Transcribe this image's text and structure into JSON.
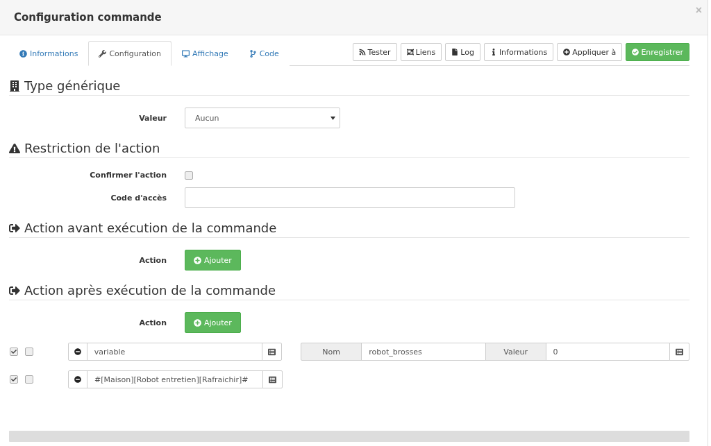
{
  "window": {
    "title": "Configuration commande",
    "close": "×"
  },
  "tabs": [
    {
      "label": "Informations",
      "selected": false
    },
    {
      "label": "Configuration",
      "selected": true
    },
    {
      "label": "Affichage",
      "selected": false
    },
    {
      "label": "Code",
      "selected": false
    }
  ],
  "toolbar": [
    {
      "label": "Tester",
      "kind": "default"
    },
    {
      "label": "Liens",
      "kind": "default"
    },
    {
      "label": "Log",
      "kind": "default"
    },
    {
      "label": "Informations",
      "kind": "default"
    },
    {
      "label": "Appliquer à",
      "kind": "default"
    },
    {
      "label": "Enregistrer",
      "kind": "success"
    }
  ],
  "generic_type": {
    "title": "Type générique",
    "label": "Valeur",
    "value": "Aucun"
  },
  "restriction": {
    "title": "Restriction de l'action",
    "confirm_label": "Confirmer l'action",
    "confirm_checked": false,
    "code_label": "Code d'accès"
  },
  "action_before": {
    "title": "Action avant exécution de la commande",
    "label": "Action",
    "button": "Ajouter"
  },
  "action_after": {
    "title": "Action après exécution de la commande",
    "label": "Action",
    "button": "Ajouter",
    "rows": [
      {
        "enabled": true,
        "background": false,
        "command": "variable",
        "options": [
          {
            "label": "Nom",
            "value": "robot_brosses"
          },
          {
            "label": "Valeur",
            "value": "0"
          }
        ]
      },
      {
        "enabled": true,
        "background": false,
        "command": "#[Maison][Robot entretien][Rafraichir]#",
        "options": []
      }
    ]
  }
}
